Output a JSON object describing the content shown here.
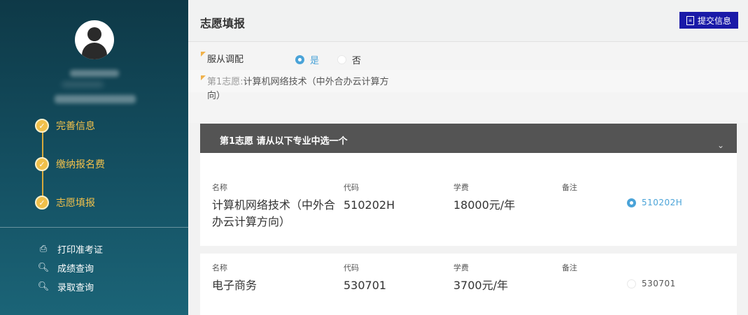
{
  "sidebar": {
    "steps": [
      {
        "label": "完善信息"
      },
      {
        "label": "缴纳报名费"
      },
      {
        "label": "志愿填报"
      }
    ],
    "menu": [
      {
        "label": "打印准考证",
        "icon": "printer-icon"
      },
      {
        "label": "成绩查询",
        "icon": "search-icon"
      },
      {
        "label": "录取查询",
        "icon": "search-icon"
      }
    ]
  },
  "header": {
    "title": "志愿填报",
    "submit_label": "提交信息"
  },
  "preferences": {
    "obey_label": "服从调配",
    "yes_label": "是",
    "no_label": "否",
    "choice_prefix": "第1志愿:",
    "choice_value": "计算机网络技术（中外合办云计算方向）"
  },
  "major_panel": {
    "title": "第1志愿 请从以下专业中选一个"
  },
  "columns": {
    "name": "名称",
    "code": "代码",
    "fee": "学费",
    "note": "备注"
  },
  "majors": [
    {
      "name": "计算机网络技术（中外合办云计算方向）",
      "code": "510202H",
      "fee": "18000元/年",
      "note": "",
      "selected": true,
      "option_code": "510202H"
    },
    {
      "name": "电子商务",
      "code": "530701",
      "fee": "3700元/年",
      "note": "",
      "selected": false,
      "option_code": "530701"
    }
  ],
  "colors": {
    "sidebar_bg": "#145062",
    "accent_gold": "#f2c14b",
    "submit_bg": "#1a1aa8",
    "panel_bg": "#545454",
    "radio_on": "#4aa3d8"
  }
}
